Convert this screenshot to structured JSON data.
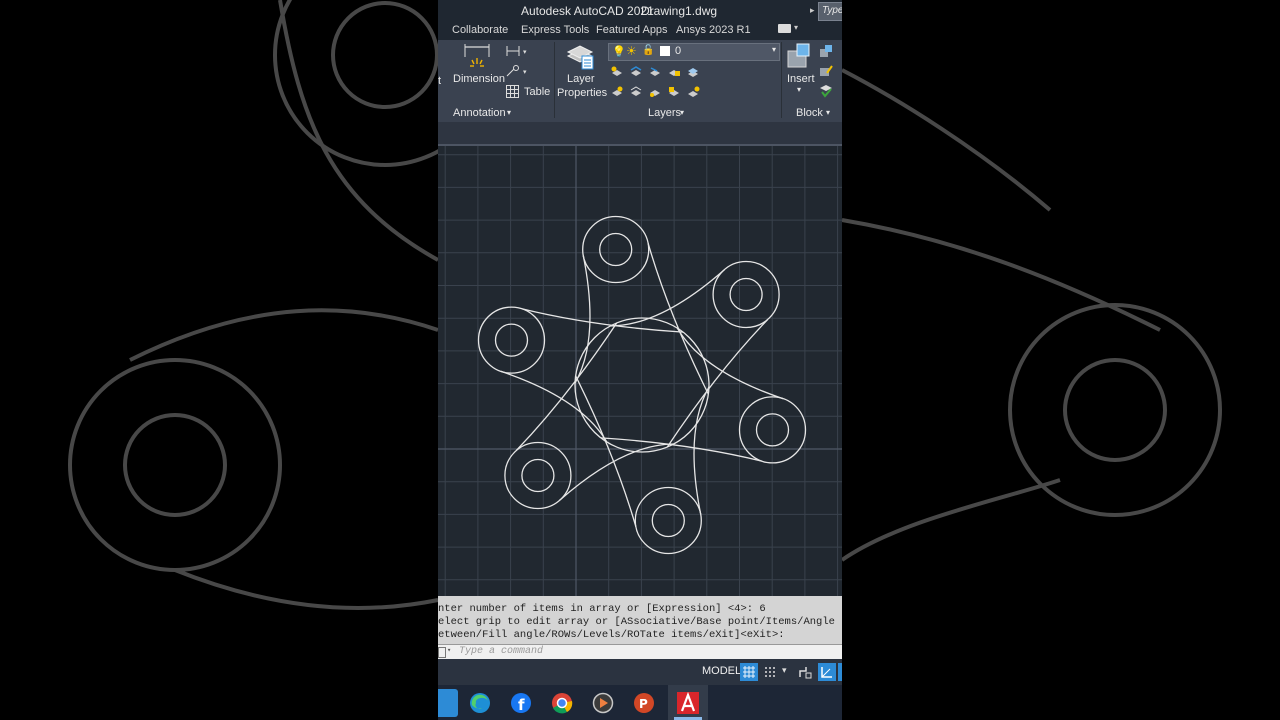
{
  "titlebar": {
    "app_name": "Autodesk AutoCAD 2021",
    "file_name": "Drawing1.dwg",
    "search_placeholder": "Type"
  },
  "tabs": [
    "Collaborate",
    "Express Tools",
    "Featured Apps",
    "Ansys  2023 R1"
  ],
  "ribbon": {
    "annotation": {
      "dimension_label": "Dimension",
      "table_label": "Table",
      "panel_title": "Annotation",
      "cut_label": "t"
    },
    "layers": {
      "layer_properties_label_1": "Layer",
      "layer_properties_label_2": "Properties",
      "current_layer": "0",
      "panel_title": "Layers"
    },
    "block": {
      "insert_label": "Insert",
      "panel_title": "Block"
    }
  },
  "command_history": [
    "nter number of items in array or [Expression] <4>: 6",
    "elect grip to edit array or [ASsociative/Base point/Items/Angle",
    "etween/Fill angle/ROWs/Levels/ROTate items/eXit]<eXit>:"
  ],
  "command_input": {
    "placeholder": "Type a command"
  },
  "status_bar": {
    "model_label": "MODEL"
  },
  "taskbar": {
    "apps": [
      "file-explorer-icon",
      "edge-icon",
      "facebook-icon",
      "chrome-icon",
      "media-player-icon",
      "powerpoint-icon",
      "autocad-icon"
    ]
  },
  "colors": {
    "accent": "#2d8bd6",
    "autocad_red": "#d9262b",
    "drawing_line": "#e6e6e6",
    "grid_line": "#3a424d"
  }
}
